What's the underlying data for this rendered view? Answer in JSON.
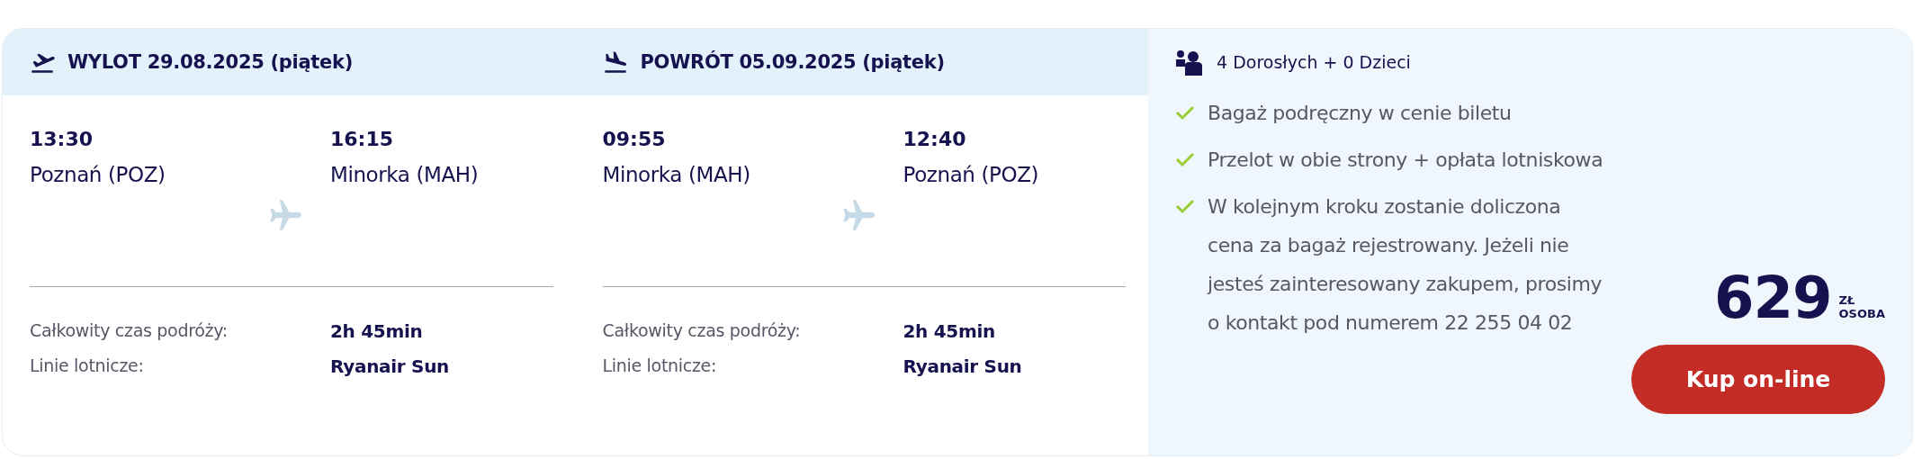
{
  "legs": [
    {
      "kind": "departure",
      "title": "WYLOT 29.08.2025 (piątek)",
      "from": {
        "time": "13:30",
        "place": "Poznań (POZ)"
      },
      "to": {
        "time": "16:15",
        "place": "Minorka (MAH)"
      },
      "details": [
        {
          "label": "Całkowity czas podróży:",
          "value": "2h 45min"
        },
        {
          "label": "Linie lotnicze:",
          "value": "Ryanair Sun"
        }
      ]
    },
    {
      "kind": "return",
      "title": "POWRÓT 05.09.2025 (piątek)",
      "from": {
        "time": "09:55",
        "place": "Minorka (MAH)"
      },
      "to": {
        "time": "12:40",
        "place": "Poznań (POZ)"
      },
      "details": [
        {
          "label": "Całkowity czas podróży:",
          "value": "2h 45min"
        },
        {
          "label": "Linie lotnicze:",
          "value": "Ryanair Sun"
        }
      ]
    }
  ],
  "passengers": "4 Dorosłych + 0 Dzieci",
  "features": [
    "Bagaż podręczny w cenie biletu",
    "Przelot w obie strony + opłata lotniskowa",
    "W kolejnym kroku zostanie doliczona cena za bagaż rejestrowany. Jeżeli nie jesteś zainteresowany zakupem, prosimy o kontakt pod numerem 22 255 04 02"
  ],
  "price": {
    "amount": "629",
    "currency": "ZŁ",
    "unit": "OSOBA"
  },
  "buy_button": "Kup on-line"
}
